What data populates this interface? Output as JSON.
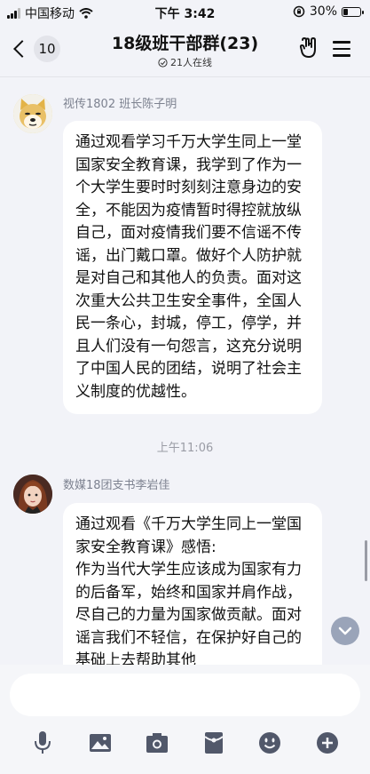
{
  "status": {
    "carrier": "中国移动",
    "time": "下午 3:42",
    "battery": "30%",
    "battery_level": 0.3
  },
  "header": {
    "back_count": "10",
    "title": "18级班干部群(23)",
    "online": "21人在线"
  },
  "messages": [
    {
      "sender": "视传1802 班长陈子明",
      "paragraphs": [
        "通过观看学习千万大学生同上一堂国家安全教育课，我学到了作为一个大学生要时时刻刻注意身边的安全，不能因为疫情暂时得控就放纵自己，面对疫情我们要不信谣不传谣，出门戴口罩。做好个人防护就是对自己和其他人的负责。面对这次重大公共卫生安全事件，全国人民一条心，封城，停工，停学，并且人们没有一句怨言，这充分说明了中国人民的团结，说明了社会主义制度的优越性。"
      ]
    },
    {
      "sender": "数媒18团支书李岩佳",
      "paragraphs": [
        "通过观看《千万大学生同上一堂国家安全教育课》感悟:",
        "作为当代大学生应该成为国家有力的后备军，始终和国家并肩作战，尽自己的力量为国家做贡献。面对谣言我们不轻信，在保护好自己的基础上去帮助其他"
      ]
    }
  ],
  "time_divider": "上午11:06",
  "toolbar": [
    "mic-icon",
    "image-icon",
    "camera-icon",
    "red-packet-icon",
    "emoji-icon",
    "plus-icon"
  ],
  "colors": {
    "background": "#f2f3f8",
    "bubble": "#ffffff",
    "scroll_button": "#9aa4b9"
  }
}
